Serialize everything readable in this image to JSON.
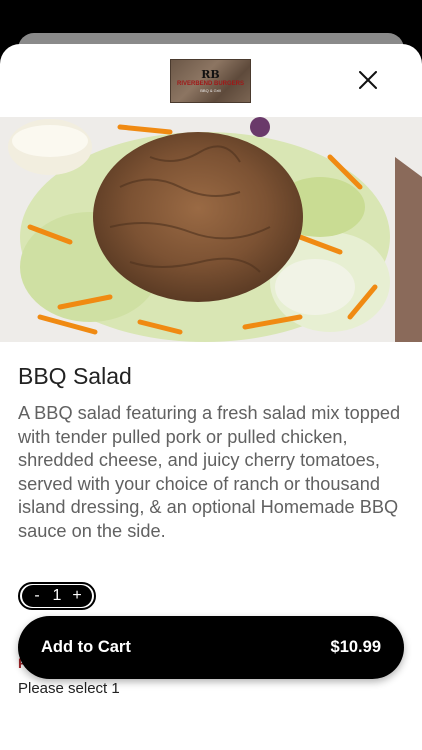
{
  "header": {
    "logo": {
      "mark": "RB",
      "name": "RIVERBEND BURGERS",
      "sub": "BBQ & Grill"
    },
    "close_icon": "close-icon"
  },
  "hero": {
    "image": "bbq-salad-photo"
  },
  "item": {
    "title": "BBQ Salad",
    "description": "A BBQ salad featuring a fresh salad mix topped with tender pulled pork or pulled chicken, shredded cheese, and juicy cherry tomatoes, served with your choice of ranch or thousand island dressing, & an optional Homemade BBQ sauce on the side."
  },
  "quantity": {
    "minus": "-",
    "value": "1",
    "plus": "+"
  },
  "options": {
    "required_marker": "R",
    "hint": "Please select 1"
  },
  "cart": {
    "label": "Add to Cart",
    "price": "$10.99"
  },
  "colors": {
    "accent": "#000000",
    "required": "#a0262a",
    "text": "#616161"
  }
}
